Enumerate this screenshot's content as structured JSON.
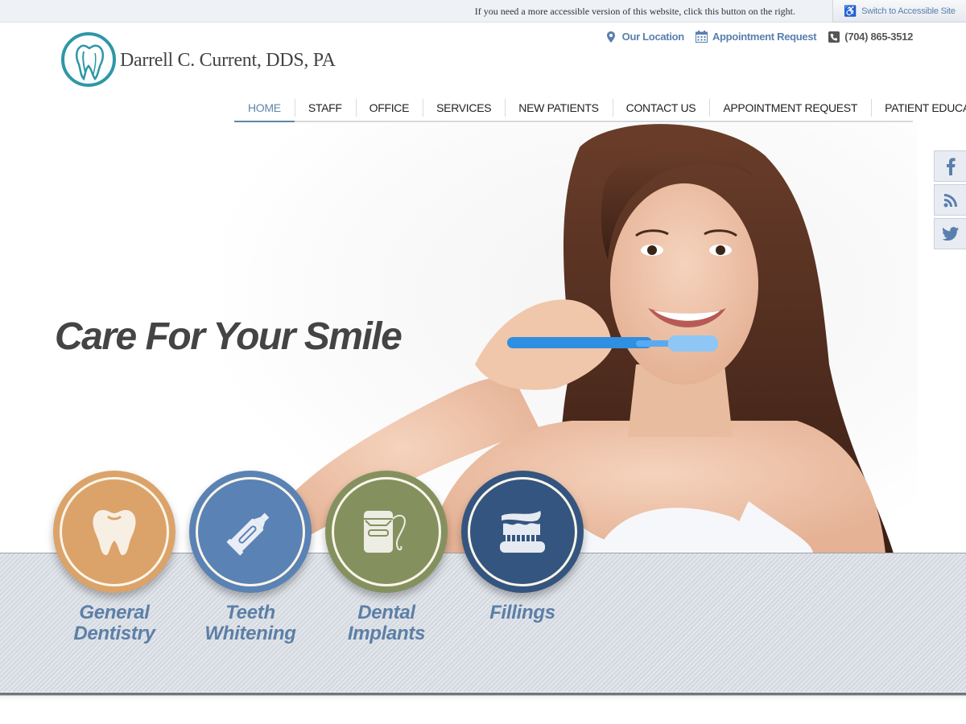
{
  "topbar": {
    "message": "If you need a more accessible version of this website, click this button on the right.",
    "accessible_button": "Switch to Accessible Site",
    "accessible_icon": "wheelchair-icon"
  },
  "header": {
    "logo_text": "Darrell C. Current, DDS, PA",
    "logo_icon": "tooth-logo-icon",
    "utility_links": [
      {
        "label": "Our Location",
        "icon": "map-pin-icon"
      },
      {
        "label": "Appointment Request",
        "icon": "calendar-icon"
      },
      {
        "label": "(704) 865-3512",
        "icon": "phone-icon"
      }
    ]
  },
  "nav": {
    "items": [
      {
        "label": "HOME",
        "active": true
      },
      {
        "label": "STAFF"
      },
      {
        "label": "OFFICE"
      },
      {
        "label": "SERVICES"
      },
      {
        "label": "NEW PATIENTS"
      },
      {
        "label": "CONTACT US"
      },
      {
        "label": "APPOINTMENT REQUEST"
      },
      {
        "label": "PATIENT EDUCATION"
      }
    ],
    "active_color": "#5f86a8"
  },
  "hero": {
    "tagline": "Care For Your Smile",
    "image_alt": "Smiling woman brushing teeth with blue toothbrush"
  },
  "social": [
    {
      "name": "facebook",
      "icon": "facebook-icon"
    },
    {
      "name": "rss",
      "icon": "rss-icon"
    },
    {
      "name": "twitter",
      "icon": "twitter-icon"
    }
  ],
  "services": [
    {
      "line1": "General",
      "line2": "Dentistry",
      "icon": "tooth-icon",
      "color": "#dba36a"
    },
    {
      "line1": "Teeth",
      "line2": "Whitening",
      "icon": "toothpaste-icon",
      "color": "#5a82b4"
    },
    {
      "line1": "Dental",
      "line2": "Implants",
      "icon": "floss-icon",
      "color": "#84915f"
    },
    {
      "line1": "Fillings",
      "line2": "",
      "icon": "toothbrush-icon",
      "color": "#34557f"
    }
  ]
}
